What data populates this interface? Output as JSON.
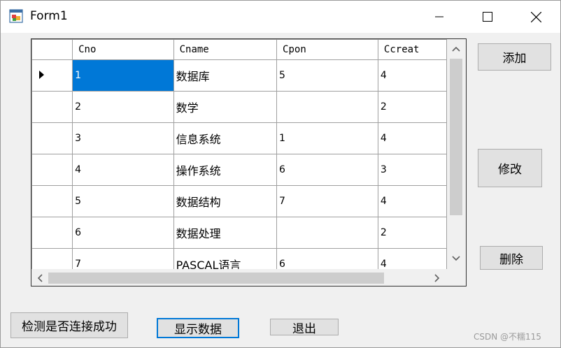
{
  "window": {
    "title": "Form1"
  },
  "grid": {
    "columns": [
      "Cno",
      "Cname",
      "Cpon",
      "Ccreat"
    ],
    "rows": [
      [
        "1",
        "数据库",
        "5",
        "4"
      ],
      [
        "2",
        "数学",
        "",
        "2"
      ],
      [
        "3",
        "信息系统",
        "1",
        "4"
      ],
      [
        "4",
        "操作系统",
        "6",
        "3"
      ],
      [
        "5",
        "数据结构",
        "7",
        "4"
      ],
      [
        "6",
        "数据处理",
        "",
        "2"
      ],
      [
        "7",
        "PASCAL语言",
        "6",
        "4"
      ]
    ],
    "selected_row": 0,
    "selected_col": 0
  },
  "buttons": {
    "add": "添加",
    "modify": "修改",
    "delete": "删除",
    "check_connection": "检测是否连接成功",
    "show_data": "显示数据",
    "exit": "退出"
  },
  "watermark": "CSDN @不糯115",
  "colors": {
    "selection": "#0078d7",
    "focus_border": "#0078d7"
  }
}
